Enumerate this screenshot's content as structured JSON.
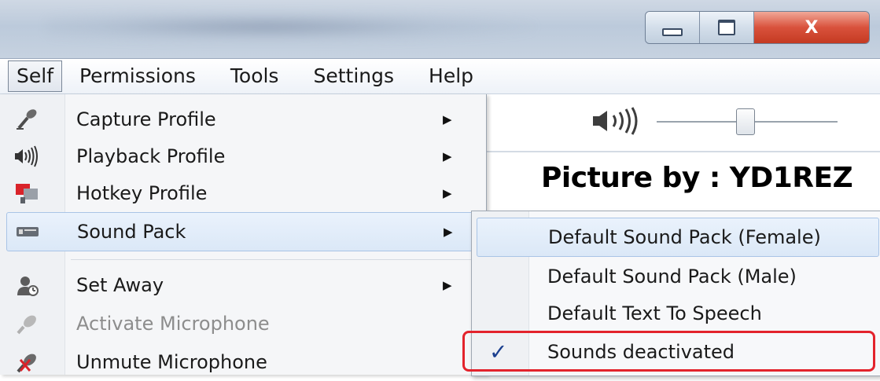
{
  "window": {
    "close_glyph": "X"
  },
  "menubar": {
    "items": [
      "Self",
      "Permissions",
      "Tools",
      "Settings",
      "Help"
    ]
  },
  "self_menu": {
    "items": [
      {
        "label": "Capture Profile",
        "icon": "microphone-icon",
        "has_submenu": true,
        "enabled": true
      },
      {
        "label": "Playback Profile",
        "icon": "speaker-icon",
        "has_submenu": true,
        "enabled": true
      },
      {
        "label": "Hotkey Profile",
        "icon": "hotkey-icon",
        "has_submenu": true,
        "enabled": true
      },
      {
        "label": "Sound Pack",
        "icon": "sound-pack-icon",
        "has_submenu": true,
        "enabled": true,
        "highlighted": true
      },
      {
        "label": "Set Away",
        "icon": "away-icon",
        "has_submenu": true,
        "enabled": true
      },
      {
        "label": "Activate Microphone",
        "icon": "microphone-icon",
        "has_submenu": false,
        "enabled": false
      },
      {
        "label": "Unmute Microphone",
        "icon": "muted-microphone-icon",
        "has_submenu": false,
        "enabled": true
      }
    ]
  },
  "sound_pack_submenu": {
    "items": [
      {
        "label": "Default Sound Pack (Female)",
        "checked": false,
        "highlighted": true
      },
      {
        "label": "Default Sound Pack (Male)",
        "checked": false
      },
      {
        "label": "Default Text To Speech",
        "checked": false
      },
      {
        "label": "Sounds deactivated",
        "checked": true
      }
    ]
  },
  "volume": {
    "icon": "speaker-icon",
    "level": 0.5
  },
  "watermark": {
    "text": "Picture by : YD1REZ"
  },
  "colors": {
    "highlight_box": "#e3232c",
    "menu_highlight": "#dbe8f7",
    "close_button": "#d9523c"
  }
}
